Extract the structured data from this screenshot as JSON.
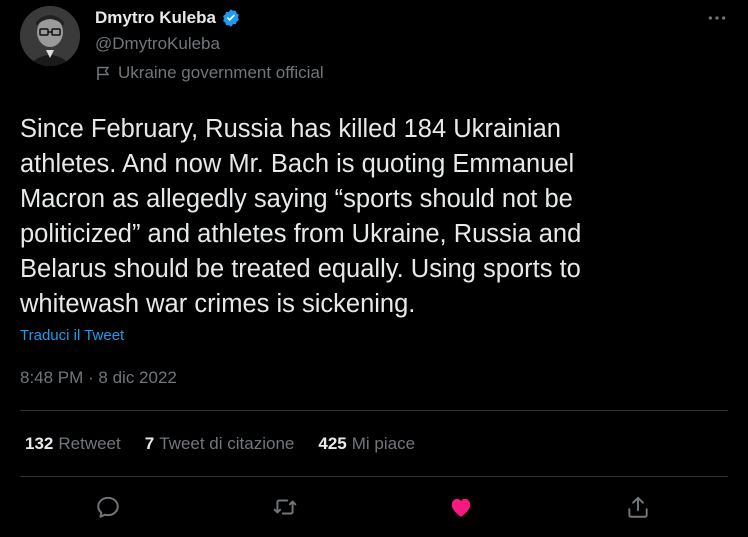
{
  "author": {
    "name": "Dmytro Kuleba",
    "handle": "@DmytroKuleba",
    "affiliation": "Ukraine government official",
    "verified_icon": "verified-badge-icon"
  },
  "tweet": {
    "text": "Since February, Russia has killed 184 Ukrainian\nathletes. And now Mr. Bach is quoting Emmanuel\nMacron as allegedly saying “sports should not be\npoliticized” and athletes from Ukraine, Russia and\nBelarus should be treated equally. Using sports to\nwhitewash war crimes is sickening.",
    "translate_label": "Traduci il Tweet",
    "timestamp": "8:48 PM · 8 dic 2022"
  },
  "stats": {
    "retweets": {
      "count": "132",
      "label": "Retweet"
    },
    "quotes": {
      "count": "7",
      "label": "Tweet di citazione"
    },
    "likes": {
      "count": "425",
      "label": "Mi piace"
    }
  },
  "actions": [
    "reply-icon",
    "retweet-icon",
    "like-icon",
    "share-icon"
  ],
  "colors": {
    "background": "#000000",
    "text": "#e7e9ea",
    "muted": "#71767b",
    "link": "#1d9bf0",
    "verified": "#1d9bf0",
    "liked": "#f91880",
    "divider": "#2f3336"
  }
}
